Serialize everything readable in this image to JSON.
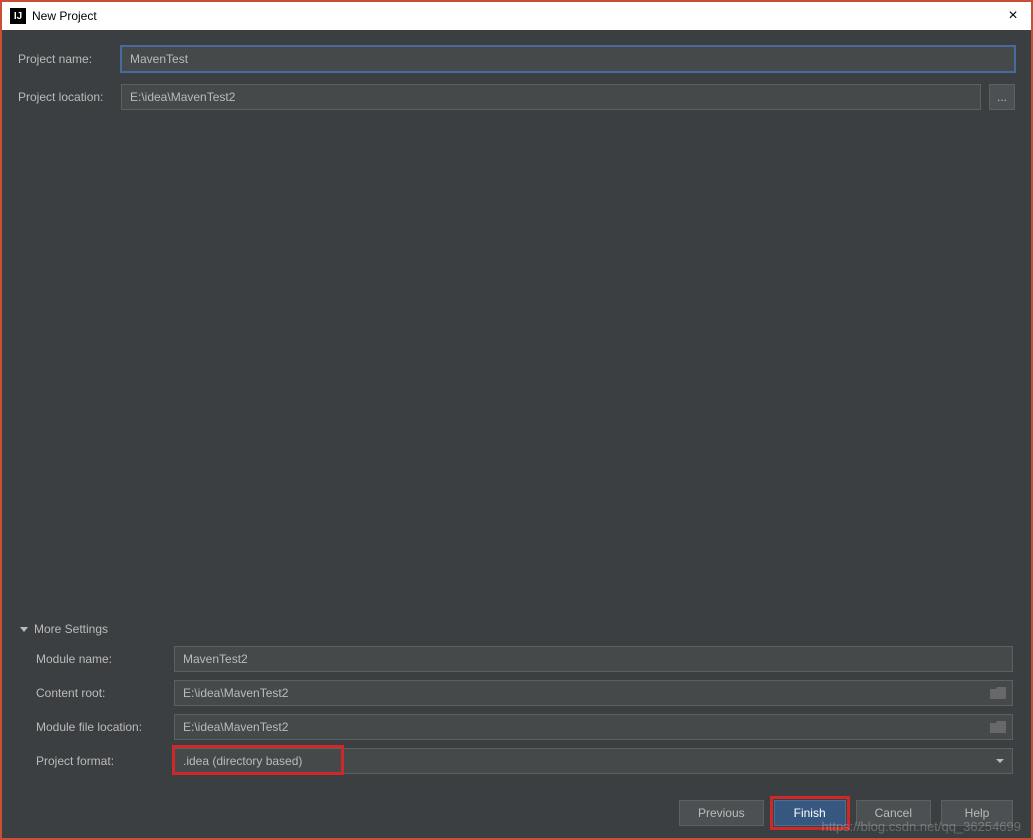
{
  "window": {
    "title": "New Project",
    "close_icon": "×"
  },
  "form": {
    "project_name_label": "Project name:",
    "project_name_value": "MavenTest",
    "project_location_label": "Project location:",
    "project_location_value": "E:\\idea\\MavenTest2",
    "browse_label": "..."
  },
  "more_settings": {
    "header": "More Settings",
    "module_name_label": "Module name:",
    "module_name_value": "MavenTest2",
    "content_root_label": "Content root:",
    "content_root_value": "E:\\idea\\MavenTest2",
    "module_file_location_label": "Module file location:",
    "module_file_location_value": "E:\\idea\\MavenTest2",
    "project_format_label": "Project format:",
    "project_format_value": ".idea (directory based)"
  },
  "buttons": {
    "previous": "Previous",
    "finish": "Finish",
    "cancel": "Cancel",
    "help": "Help"
  },
  "watermark": "https://blog.csdn.net/qq_36254699"
}
